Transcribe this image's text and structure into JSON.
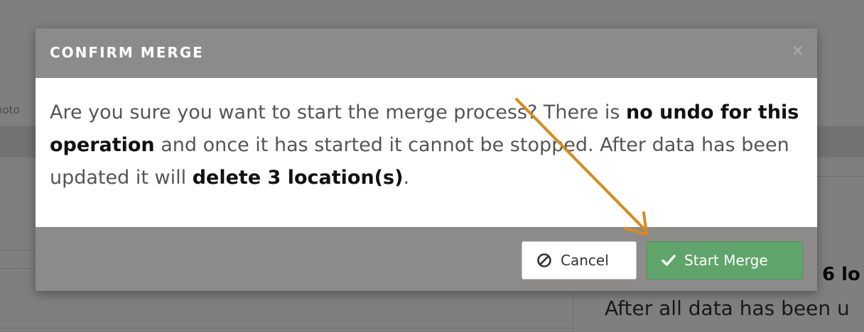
{
  "background": {
    "photo_fragment": "hoto",
    "count_fragment": "6 lo",
    "after_fragment": "After all data has been u"
  },
  "modal": {
    "title": "CONFIRM MERGE",
    "close_glyph": "×",
    "body": {
      "part1": "Are you sure you want to start the merge process? There is ",
      "bold1": "no undo for this operation",
      "part2": " and once it has started it cannot be stopped. After data has been updated it will ",
      "bold2": "delete 3 location(s)",
      "part3": "."
    },
    "buttons": {
      "cancel_label": "Cancel",
      "start_label": "Start Merge"
    }
  },
  "colors": {
    "header_bg": "#8c8b89",
    "start_button": "#5fa46a",
    "annotation_arrow": "#d98a1c"
  },
  "icons": {
    "cancel": "ban-icon",
    "start": "check-icon",
    "close": "close-icon"
  }
}
